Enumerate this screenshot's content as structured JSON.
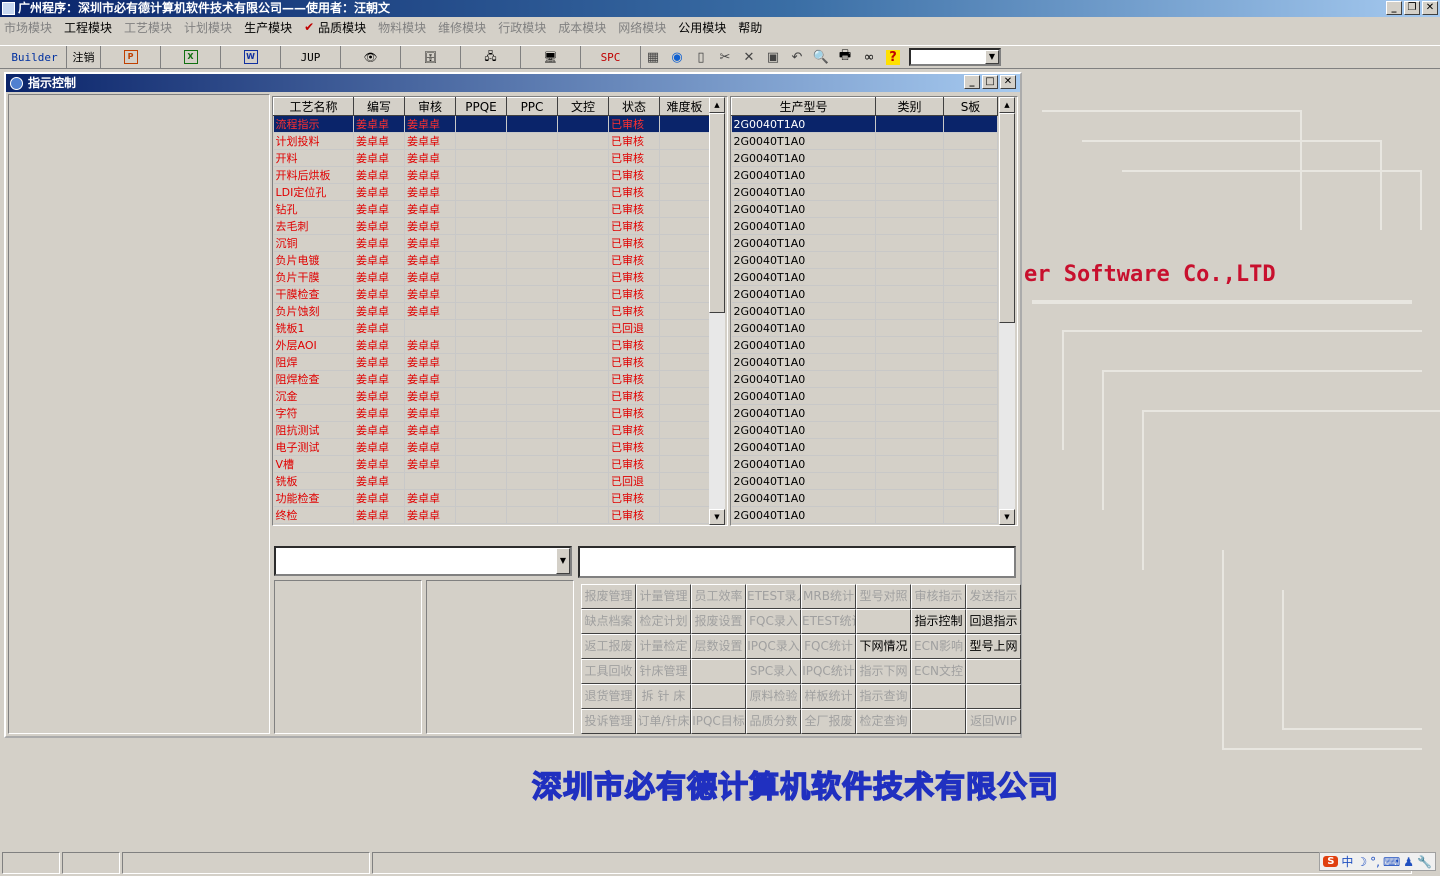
{
  "window": {
    "title": "广州程序：深圳市必有德计算机软件技术有限公司——使用者：汪朝文"
  },
  "menu": {
    "items": [
      {
        "label": "市场模块",
        "enabled": false
      },
      {
        "label": "工程模块",
        "enabled": true
      },
      {
        "label": "工艺模块",
        "enabled": false
      },
      {
        "label": "计划模块",
        "enabled": false
      },
      {
        "label": "生产模块",
        "enabled": true
      },
      {
        "label": "品质模块",
        "enabled": true,
        "checked": true
      },
      {
        "label": "物料模块",
        "enabled": false
      },
      {
        "label": "维修模块",
        "enabled": false
      },
      {
        "label": "行政模块",
        "enabled": false
      },
      {
        "label": "成本模块",
        "enabled": false
      },
      {
        "label": "网络模块",
        "enabled": false
      },
      {
        "label": "公用模块",
        "enabled": true
      },
      {
        "label": "帮助",
        "enabled": true
      }
    ]
  },
  "toolbar": {
    "builder": "Builder",
    "logout": "注销",
    "jup": "JUP",
    "spc": "SPC",
    "ppt_icon": "P",
    "xls_icon": "X",
    "doc_icon": "W",
    "help": "?"
  },
  "child": {
    "title": "指示控制"
  },
  "grid_left": {
    "headers": [
      "工艺名称",
      "编写",
      "审核",
      "PPQE",
      "PPC",
      "文控",
      "状态",
      "难度板"
    ],
    "rows": [
      [
        "流程指示",
        "姜卓卓",
        "姜卓卓",
        "",
        "",
        "",
        "已审核",
        ""
      ],
      [
        "计划投料",
        "姜卓卓",
        "姜卓卓",
        "",
        "",
        "",
        "已审核",
        ""
      ],
      [
        "开料",
        "姜卓卓",
        "姜卓卓",
        "",
        "",
        "",
        "已审核",
        ""
      ],
      [
        "开料后烘板",
        "姜卓卓",
        "姜卓卓",
        "",
        "",
        "",
        "已审核",
        ""
      ],
      [
        "LDI定位孔",
        "姜卓卓",
        "姜卓卓",
        "",
        "",
        "",
        "已审核",
        ""
      ],
      [
        "钻孔",
        "姜卓卓",
        "姜卓卓",
        "",
        "",
        "",
        "已审核",
        ""
      ],
      [
        "去毛刺",
        "姜卓卓",
        "姜卓卓",
        "",
        "",
        "",
        "已审核",
        ""
      ],
      [
        "沉铜",
        "姜卓卓",
        "姜卓卓",
        "",
        "",
        "",
        "已审核",
        ""
      ],
      [
        "负片电镀",
        "姜卓卓",
        "姜卓卓",
        "",
        "",
        "",
        "已审核",
        ""
      ],
      [
        "负片干膜",
        "姜卓卓",
        "姜卓卓",
        "",
        "",
        "",
        "已审核",
        ""
      ],
      [
        "干膜检查",
        "姜卓卓",
        "姜卓卓",
        "",
        "",
        "",
        "已审核",
        ""
      ],
      [
        "负片蚀刻",
        "姜卓卓",
        "姜卓卓",
        "",
        "",
        "",
        "已审核",
        ""
      ],
      [
        "铣板1",
        "姜卓卓",
        "",
        "",
        "",
        "",
        "已回退",
        ""
      ],
      [
        "外层AOI",
        "姜卓卓",
        "姜卓卓",
        "",
        "",
        "",
        "已审核",
        ""
      ],
      [
        "阻焊",
        "姜卓卓",
        "姜卓卓",
        "",
        "",
        "",
        "已审核",
        ""
      ],
      [
        "阻焊检查",
        "姜卓卓",
        "姜卓卓",
        "",
        "",
        "",
        "已审核",
        ""
      ],
      [
        "沉金",
        "姜卓卓",
        "姜卓卓",
        "",
        "",
        "",
        "已审核",
        ""
      ],
      [
        "字符",
        "姜卓卓",
        "姜卓卓",
        "",
        "",
        "",
        "已审核",
        ""
      ],
      [
        "阻抗测试",
        "姜卓卓",
        "姜卓卓",
        "",
        "",
        "",
        "已审核",
        ""
      ],
      [
        "电子测试",
        "姜卓卓",
        "姜卓卓",
        "",
        "",
        "",
        "已审核",
        ""
      ],
      [
        "V槽",
        "姜卓卓",
        "姜卓卓",
        "",
        "",
        "",
        "已审核",
        ""
      ],
      [
        "铣板",
        "姜卓卓",
        "",
        "",
        "",
        "",
        "已回退",
        ""
      ],
      [
        "功能检查",
        "姜卓卓",
        "姜卓卓",
        "",
        "",
        "",
        "已审核",
        ""
      ],
      [
        "终检",
        "姜卓卓",
        "姜卓卓",
        "",
        "",
        "",
        "已审核",
        ""
      ]
    ]
  },
  "grid_right": {
    "headers": [
      "生产型号",
      "类别",
      "S板"
    ],
    "rows": [
      [
        "2G0040T1A0",
        "",
        ""
      ],
      [
        "2G0040T1A0",
        "",
        ""
      ],
      [
        "2G0040T1A0",
        "",
        ""
      ],
      [
        "2G0040T1A0",
        "",
        ""
      ],
      [
        "2G0040T1A0",
        "",
        ""
      ],
      [
        "2G0040T1A0",
        "",
        ""
      ],
      [
        "2G0040T1A0",
        "",
        ""
      ],
      [
        "2G0040T1A0",
        "",
        ""
      ],
      [
        "2G0040T1A0",
        "",
        ""
      ],
      [
        "2G0040T1A0",
        "",
        ""
      ],
      [
        "2G0040T1A0",
        "",
        ""
      ],
      [
        "2G0040T1A0",
        "",
        ""
      ],
      [
        "2G0040T1A0",
        "",
        ""
      ],
      [
        "2G0040T1A0",
        "",
        ""
      ],
      [
        "2G0040T1A0",
        "",
        ""
      ],
      [
        "2G0040T1A0",
        "",
        ""
      ],
      [
        "2G0040T1A0",
        "",
        ""
      ],
      [
        "2G0040T1A0",
        "",
        ""
      ],
      [
        "2G0040T1A0",
        "",
        ""
      ],
      [
        "2G0040T1A0",
        "",
        ""
      ],
      [
        "2G0040T1A0",
        "",
        ""
      ],
      [
        "2G0040T1A0",
        "",
        ""
      ],
      [
        "2G0040T1A0",
        "",
        ""
      ],
      [
        "2G0040T1A0",
        "",
        ""
      ]
    ]
  },
  "function_buttons": [
    {
      "label": "报废管理",
      "enabled": false
    },
    {
      "label": "计量管理",
      "enabled": false
    },
    {
      "label": "员工效率",
      "enabled": false
    },
    {
      "label": "ETEST录入",
      "enabled": false
    },
    {
      "label": "MRB统计",
      "enabled": false
    },
    {
      "label": "型号对照",
      "enabled": false
    },
    {
      "label": "审核指示",
      "enabled": false
    },
    {
      "label": "发送指示",
      "enabled": false
    },
    {
      "label": "缺点档案",
      "enabled": false
    },
    {
      "label": "检定计划",
      "enabled": false
    },
    {
      "label": "报废设置",
      "enabled": false
    },
    {
      "label": "FQC录入",
      "enabled": false
    },
    {
      "label": "ETEST统计",
      "enabled": false
    },
    {
      "label": "",
      "enabled": false
    },
    {
      "label": "指示控制",
      "enabled": true
    },
    {
      "label": "回退指示",
      "enabled": true
    },
    {
      "label": "返工报废",
      "enabled": false
    },
    {
      "label": "计量检定",
      "enabled": false
    },
    {
      "label": "层数设置",
      "enabled": false
    },
    {
      "label": "IPQC录入",
      "enabled": false
    },
    {
      "label": "FQC统计",
      "enabled": false
    },
    {
      "label": "下网情况",
      "enabled": true
    },
    {
      "label": "ECN影响",
      "enabled": false
    },
    {
      "label": "型号上网",
      "enabled": true
    },
    {
      "label": "工具回收",
      "enabled": false
    },
    {
      "label": "针床管理",
      "enabled": false
    },
    {
      "label": "",
      "enabled": false
    },
    {
      "label": "SPC录入",
      "enabled": false
    },
    {
      "label": "IPQC统计",
      "enabled": false
    },
    {
      "label": "指示下网",
      "enabled": false
    },
    {
      "label": "ECN文控",
      "enabled": false
    },
    {
      "label": "",
      "enabled": false
    },
    {
      "label": "退货管理",
      "enabled": false
    },
    {
      "label": "拆 针 床",
      "enabled": false
    },
    {
      "label": "",
      "enabled": false
    },
    {
      "label": "原料检验",
      "enabled": false
    },
    {
      "label": "样板统计",
      "enabled": false
    },
    {
      "label": "指示查询",
      "enabled": false
    },
    {
      "label": "",
      "enabled": false
    },
    {
      "label": "",
      "enabled": false
    },
    {
      "label": "投诉管理",
      "enabled": false
    },
    {
      "label": "订单/针床",
      "enabled": false
    },
    {
      "label": "IPQC目标",
      "enabled": false
    },
    {
      "label": "品质分数",
      "enabled": false
    },
    {
      "label": "全厂报废",
      "enabled": false
    },
    {
      "label": "检定查询",
      "enabled": false
    },
    {
      "label": "",
      "enabled": false
    },
    {
      "label": "返回WIP",
      "enabled": false
    }
  ],
  "background": {
    "brand": "er Software Co.,LTD",
    "company": "深圳市必有德计算机软件技术有限公司"
  },
  "tray": {
    "ime": "中"
  }
}
